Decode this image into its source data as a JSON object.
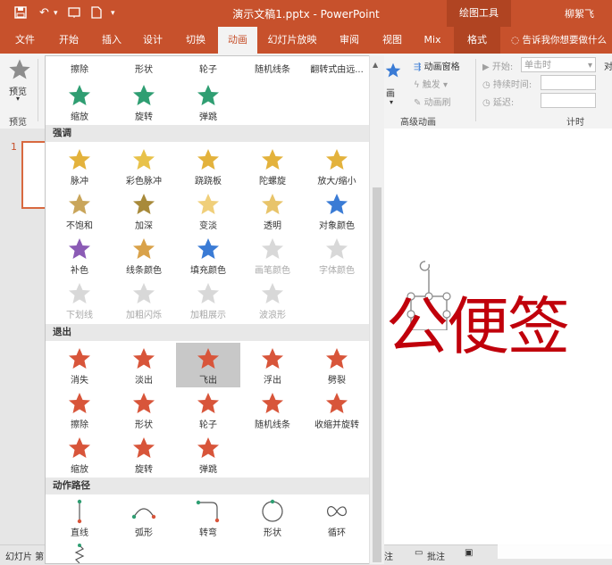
{
  "titlebar": {
    "title": "演示文稿1.pptx - PowerPoint",
    "context_group": "绘图工具",
    "user": "柳絮飞"
  },
  "tabs": [
    "文件",
    "开始",
    "插入",
    "设计",
    "切换",
    "动画",
    "幻灯片放映",
    "审阅",
    "视图",
    "Mix",
    "格式"
  ],
  "active_tab": "动画",
  "tell_me": "告诉我你想要做什么",
  "ribbon": {
    "preview_label": "预览",
    "preview_group": "预览",
    "add_animation": "添加动画",
    "animation_pane": "动画窗格",
    "trigger": "触发",
    "painter": "动画刷",
    "advanced_group": "高级动画",
    "start_label": "开始:",
    "start_value": "单击时",
    "duration_label": "持续时间:",
    "delay_label": "延迟:",
    "timing_group": "计时",
    "right_cut": "对"
  },
  "thumbs": {
    "number": "1"
  },
  "slide": {
    "text": "公便签"
  },
  "status": {
    "left": "幻灯片 第",
    "notes_prefix": "注",
    "comments": "批注"
  },
  "gallery": {
    "top_row_labels": [
      "擦除",
      "形状",
      "轮子",
      "随机线条",
      "翻转式由远..."
    ],
    "top_items": [
      "缩放",
      "旋转",
      "弹跳"
    ],
    "emphasis": {
      "title": "强调",
      "items": [
        "脉冲",
        "彩色脉冲",
        "跷跷板",
        "陀螺旋",
        "放大/缩小",
        "不饱和",
        "加深",
        "变淡",
        "透明",
        "对象颜色",
        "补色",
        "线条颜色",
        "填充颜色",
        "画笔颜色",
        "字体颜色",
        "下划线",
        "加粗闪烁",
        "加粗展示",
        "波浪形"
      ]
    },
    "exit": {
      "title": "退出",
      "items": [
        "消失",
        "淡出",
        "飞出",
        "浮出",
        "劈裂",
        "擦除",
        "形状",
        "轮子",
        "随机线条",
        "收缩并旋转",
        "缩放",
        "旋转",
        "弹跳"
      ],
      "selected": "飞出"
    },
    "paths": {
      "title": "动作路径",
      "items": [
        "直线",
        "弧形",
        "转弯",
        "形状",
        "循环"
      ]
    }
  },
  "colors": {
    "accent": "#c7512c",
    "entrance": "#2f9e72",
    "emphasis": "#e3b23c",
    "exit": "#d8553a",
    "slide_text": "#c0000b"
  }
}
